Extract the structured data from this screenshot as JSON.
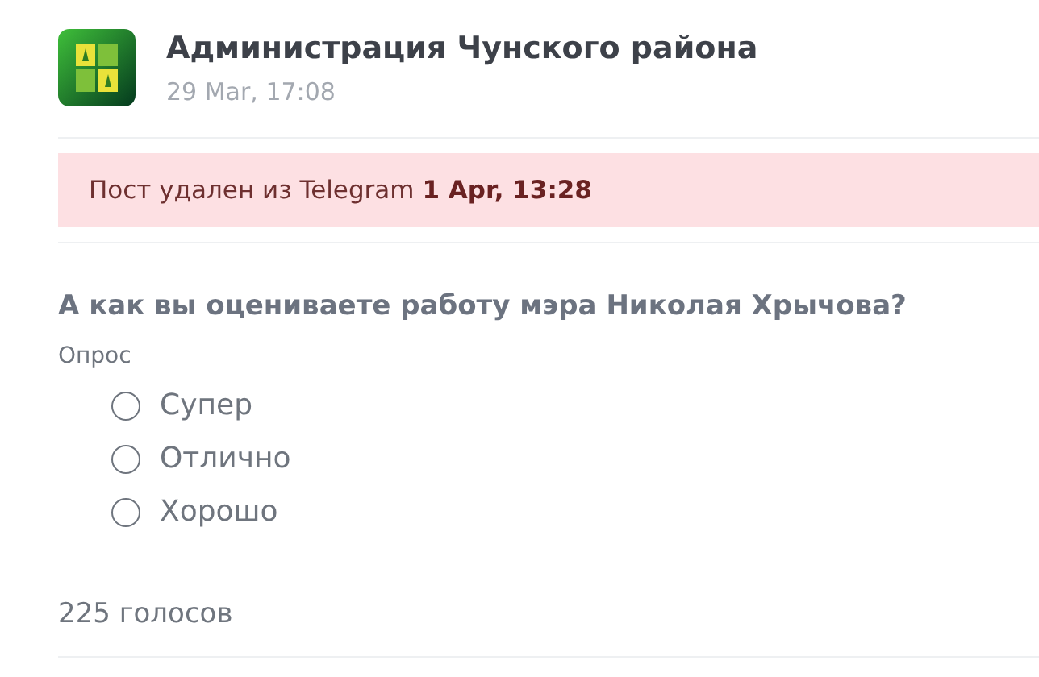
{
  "channel": {
    "name": "Администрация Чунского района",
    "time": "29 Mar, 17:08"
  },
  "notice": {
    "text": "Пост удален из Telegram **1 Apr, 13:28**"
  },
  "poll": {
    "question": "А как вы оцениваете работу мэра Николая Хрычова?",
    "label": "Опрос",
    "options": [
      {
        "label": "Супер",
        "selected": false
      },
      {
        "label": "Отлично",
        "selected": false
      },
      {
        "label": "Хорошо",
        "selected": false
      }
    ],
    "votes": "225 голосов"
  }
}
